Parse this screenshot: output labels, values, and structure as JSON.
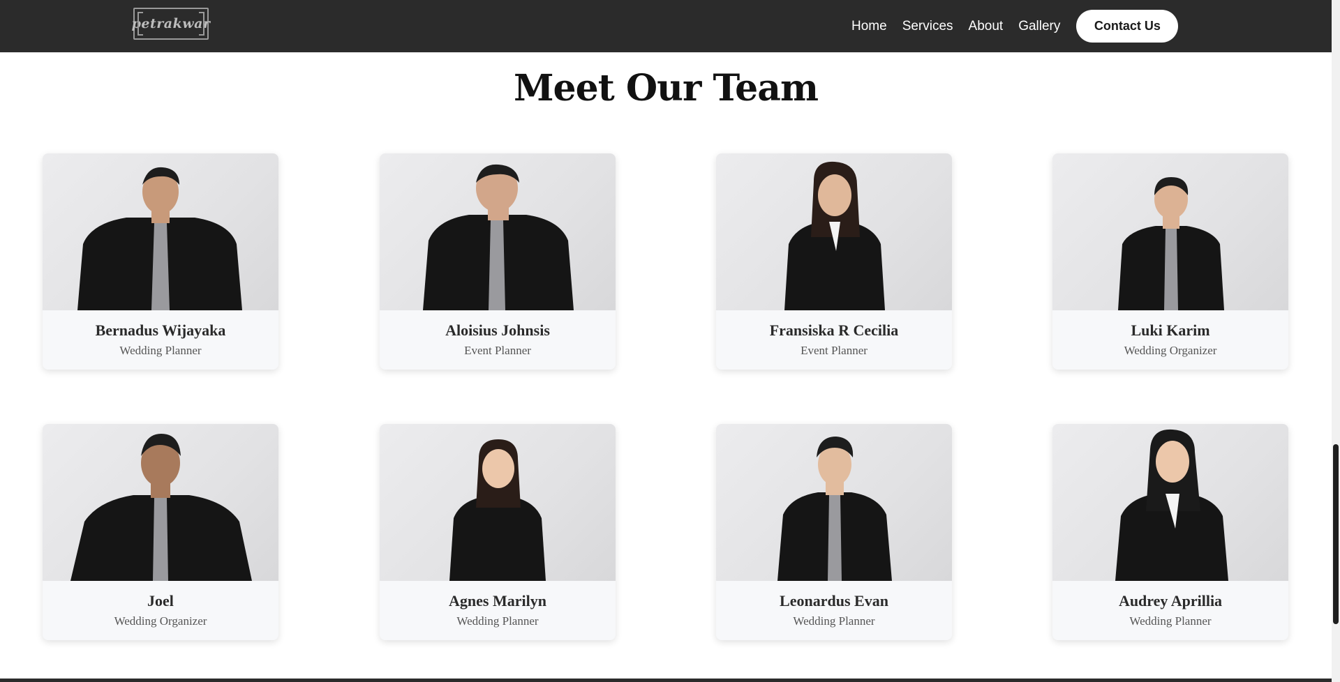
{
  "header": {
    "logo_text": "petrakwar",
    "nav": [
      "Home",
      "Services",
      "About",
      "Gallery"
    ],
    "contact_label": "Contact Us"
  },
  "section": {
    "title": "Meet Our Team"
  },
  "team": [
    {
      "name": "Bernadus Wijayaka",
      "role": "Wedding Planner"
    },
    {
      "name": "Aloisius Johnsis",
      "role": "Event Planner"
    },
    {
      "name": "Fransiska R Cecilia",
      "role": "Event Planner"
    },
    {
      "name": "Luki Karim",
      "role": "Wedding Organizer"
    },
    {
      "name": "Joel",
      "role": "Wedding Organizer"
    },
    {
      "name": "Agnes Marilyn",
      "role": "Wedding Planner"
    },
    {
      "name": "Leonardus Evan",
      "role": "Wedding Planner"
    },
    {
      "name": "Audrey Aprillia",
      "role": "Wedding Planner"
    }
  ],
  "colors": {
    "nav_bg": "#2b2b2b",
    "card_bg": "#f7f8fa",
    "suit": "#151515",
    "tie": "#9a9a9e"
  }
}
